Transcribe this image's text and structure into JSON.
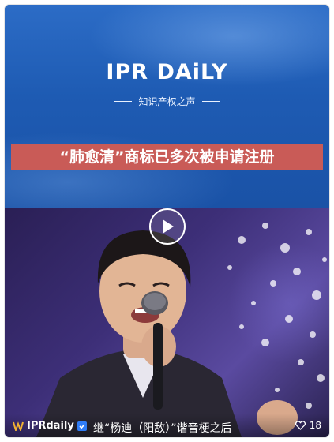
{
  "banner": {
    "logo": "IPR DAiLY",
    "tagline": "知识产权之声",
    "headline": "“肺愈清”商标已多次被申请注册"
  },
  "video": {
    "play_icon": "play-icon"
  },
  "footer": {
    "account_icon": "logo-icon",
    "account_name": "IPRdaily",
    "verified_icon": "verified-check-icon",
    "caption": "继“杨迪（阳敌）”谐音梗之后",
    "like_icon": "heart-icon",
    "like_count": "18"
  },
  "colors": {
    "banner_blue": "#1e5bb3",
    "headline_red": "#c95b57",
    "verified_blue": "#2f7cf6"
  }
}
